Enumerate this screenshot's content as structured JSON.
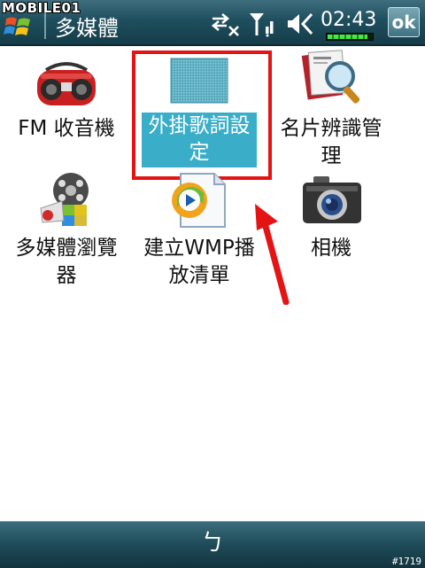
{
  "watermark": {
    "text": "MOBILE01"
  },
  "titlebar": {
    "title": "多媒體",
    "clock": "02:43",
    "ok_label": "ok",
    "battery_level": 0.9
  },
  "items": [
    {
      "label": "FM 收音機"
    },
    {
      "label_line1": "外掛歌詞設",
      "label_line2": "定"
    },
    {
      "label_line1": "名片辨識管",
      "label_line2": "理"
    },
    {
      "label_line1": "多媒體瀏覽",
      "label_line2": "器"
    },
    {
      "label_line1": "建立WMP播",
      "label_line2": "放清單"
    },
    {
      "label": "相機"
    }
  ],
  "bottombar": {
    "softkey": "ㄅ"
  },
  "photo_id": "#1719",
  "colors": {
    "highlight": "#3aaec9",
    "annotation_red": "#e41414",
    "bar": "#1f4f5e"
  }
}
